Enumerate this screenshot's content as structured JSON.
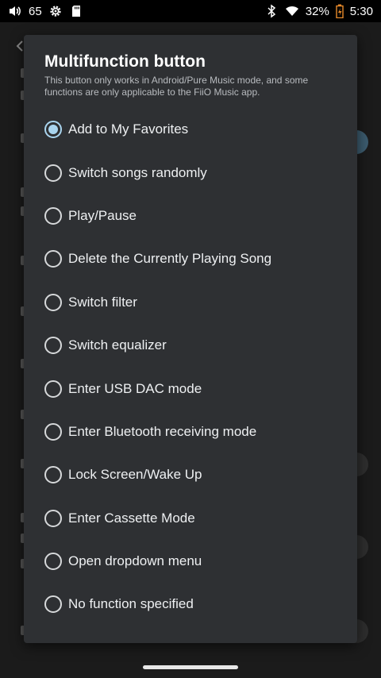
{
  "status_bar": {
    "volume": "65",
    "battery_percent": "32%",
    "time": "5:30",
    "icons": [
      "volume-icon",
      "settings-gear-icon",
      "sd-card-icon",
      "bluetooth-icon",
      "wifi-icon",
      "battery-icon"
    ]
  },
  "dialog": {
    "title": "Multifunction button",
    "description": "This button only works in Android/Pure Music mode, and some functions are only applicable to the FiiO Music app.",
    "options": [
      {
        "label": "Add to My Favorites",
        "selected": true
      },
      {
        "label": "Switch songs randomly",
        "selected": false
      },
      {
        "label": "Play/Pause",
        "selected": false
      },
      {
        "label": "Delete the Currently Playing Song",
        "selected": false
      },
      {
        "label": "Switch filter",
        "selected": false
      },
      {
        "label": "Switch equalizer",
        "selected": false
      },
      {
        "label": "Enter USB DAC mode",
        "selected": false
      },
      {
        "label": "Enter Bluetooth receiving mode",
        "selected": false
      },
      {
        "label": "Lock Screen/Wake Up",
        "selected": false
      },
      {
        "label": "Enter Cassette Mode",
        "selected": false
      },
      {
        "label": "Open dropdown menu",
        "selected": false
      },
      {
        "label": "No function specified",
        "selected": false
      }
    ]
  },
  "colors": {
    "dialog_bg": "#2e3033",
    "radio_selected": "#a9d4ee",
    "radio_unselected": "#d6d8da"
  }
}
